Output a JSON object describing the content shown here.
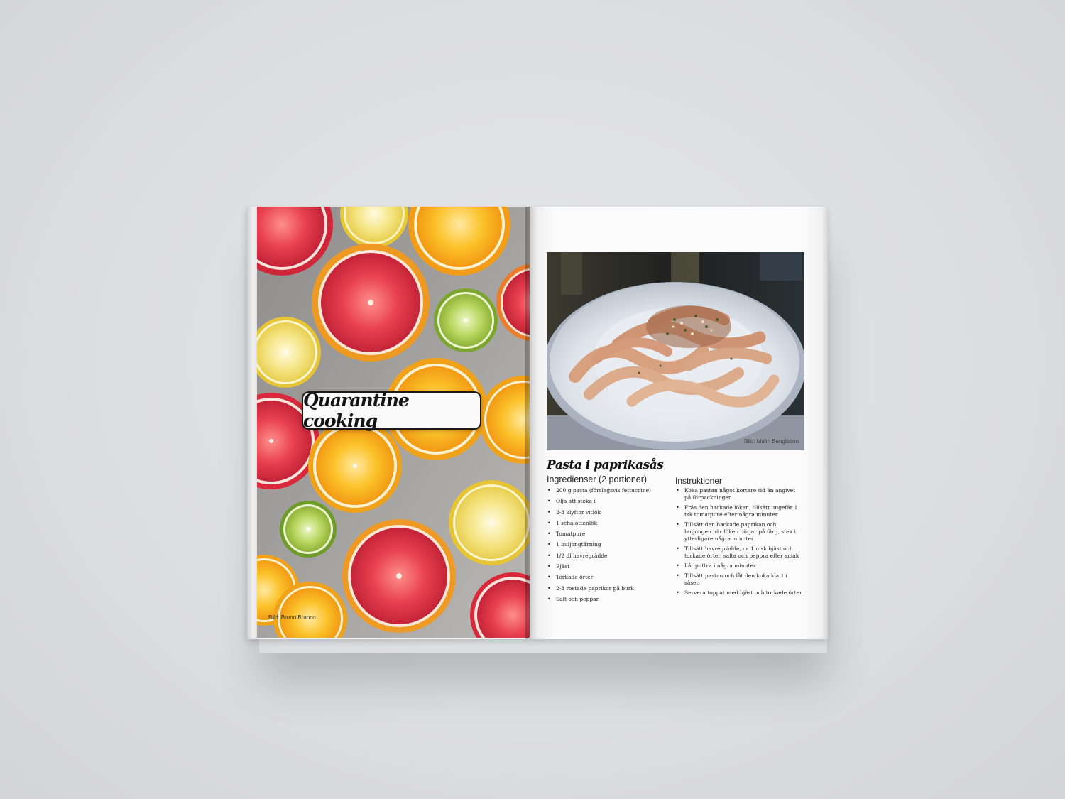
{
  "left_page": {
    "title": "Quarantine cooking",
    "photo_credit": "Bild: Bruno Branco"
  },
  "right_page": {
    "photo_credit": "Bild: Malin Bengtsson",
    "recipe_title": "Pasta i paprikasås",
    "ingredients_heading": "Ingredienser (2 portioner)",
    "instructions_heading": "Instruktioner",
    "ingredients": [
      "200 g pasta (förslagsvis fettuccine)",
      "Olja att steka i",
      "2-3 klyftor vitlök",
      "1 schalottenlök",
      "Tomatpuré",
      "1 buljongtärning",
      "1/2 dl havregrädde",
      "Bjäst",
      "Torkade örter",
      "2-3 rostade paprikor på burk",
      "Salt och peppar"
    ],
    "instructions": [
      "Koka pastan något kortare tid än angivet på förpackningen",
      "Fräs den hackade löken, tillsätt ungefär 1 tsk tomatpuré efter några minuter",
      "Tillsätt den hackade paprikan och buljongen när löken börjar på färg, stek i ytterligare några minuter",
      "Tillsätt havregrädde, ca 1 msk bjäst och torkade örter, salta och peppra efter smak",
      "Låt puttra i några minuter",
      "Tillsätt pastan och låt den koka klart i såsen",
      "Servera toppat med bjäst och torkade örter"
    ]
  },
  "colors": {
    "background": "#dcdddf",
    "grapefruit": "#e23a4a",
    "orange": "#f6b81c",
    "lemon": "#f2e27a",
    "lime": "#a6c94c",
    "title_text": "#141414"
  }
}
